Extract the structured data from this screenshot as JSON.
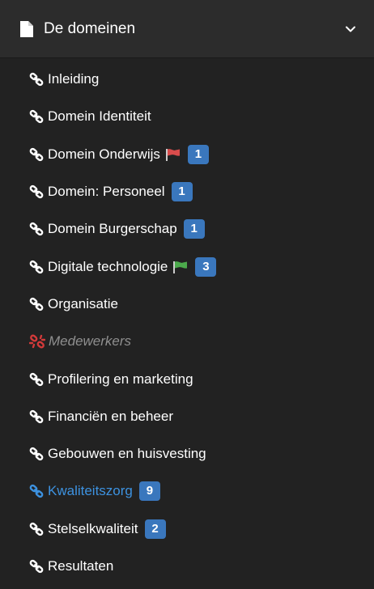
{
  "header": {
    "title": "De domeinen",
    "icon": "document-icon",
    "toggle_icon": "chevron-down-icon"
  },
  "colors": {
    "background": "#222222",
    "header_background": "#2c2c2c",
    "badge": "#3a77bd",
    "active_link": "#3d92e0",
    "disabled_text": "#8f8f8f",
    "broken_link_icon": "#d23a3a",
    "flag_red": "#d94c4c",
    "flag_green": "#4caa4c"
  },
  "items": [
    {
      "label": "Inleiding",
      "icon": "link-icon"
    },
    {
      "label": "Domein Identiteit",
      "icon": "link-icon"
    },
    {
      "label": "Domein Onderwijs",
      "icon": "link-icon",
      "flag": "red-flag-icon",
      "badge": "1"
    },
    {
      "label": "Domein: Personeel",
      "icon": "link-icon",
      "badge": "1"
    },
    {
      "label": "Domein Burgerschap",
      "icon": "link-icon",
      "badge": "1"
    },
    {
      "label": "Digitale technologie",
      "icon": "link-icon",
      "flag": "green-flag-icon",
      "badge": "3"
    },
    {
      "label": "Organisatie",
      "icon": "link-icon"
    },
    {
      "label": "Medewerkers",
      "icon": "broken-link-icon",
      "state": "disabled"
    },
    {
      "label": "Profilering en marketing",
      "icon": "link-icon"
    },
    {
      "label": "Financiën en beheer",
      "icon": "link-icon"
    },
    {
      "label": "Gebouwen en huisvesting",
      "icon": "link-icon"
    },
    {
      "label": "Kwaliteitszorg",
      "icon": "link-icon",
      "badge": "9",
      "state": "active"
    },
    {
      "label": "Stelselkwaliteit",
      "icon": "link-icon",
      "badge": "2"
    },
    {
      "label": "Resultaten",
      "icon": "link-icon"
    }
  ]
}
